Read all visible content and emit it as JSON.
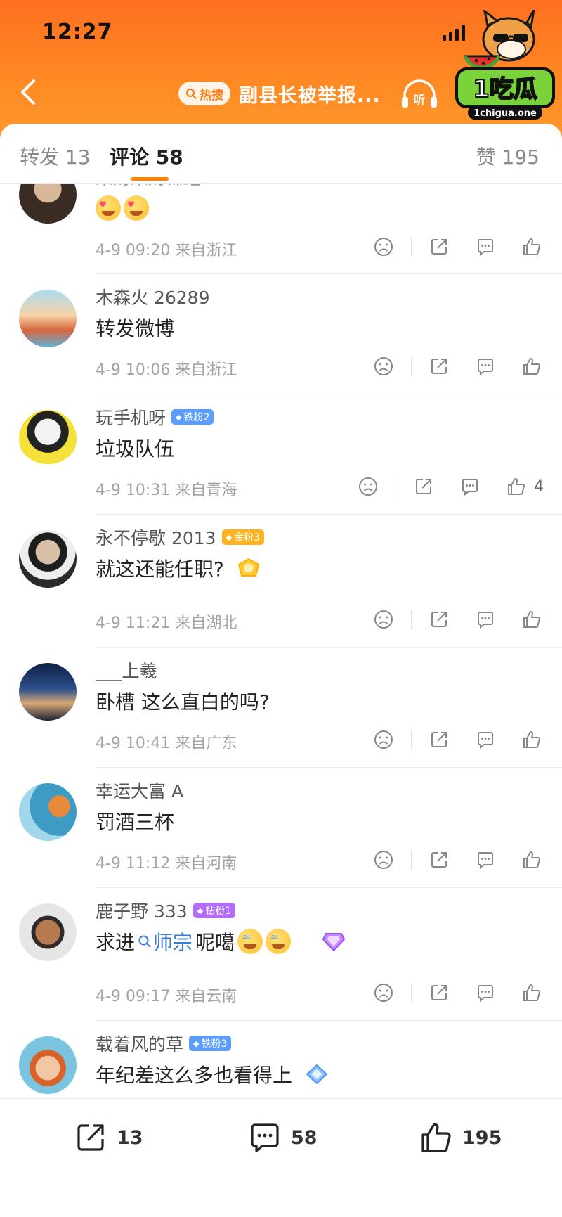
{
  "status_bar": {
    "time": "12:27"
  },
  "header": {
    "hot_label": "热搜",
    "topic_title": "副县长被举报...",
    "listen_label": "听",
    "logo_text": "1吃瓜",
    "logo_domain": "1chigua.one"
  },
  "tabs": {
    "repost": "转发 13",
    "comment": "评论 58",
    "like": "赞 195"
  },
  "comments": [
    {
      "name": "来财来财锦鲤",
      "badge": "",
      "text": "",
      "emojis": [
        "heart-eyes-emoji",
        "heart-eyes-emoji"
      ],
      "meta": "4-9 09:20  来自浙江",
      "likes": ""
    },
    {
      "name": "木森火 26289",
      "badge": "",
      "text": "转发微博",
      "meta": "4-9 10:06  来自浙江",
      "likes": ""
    },
    {
      "name": "玩手机呀",
      "badge": "铁粉2",
      "text": "垃圾队伍",
      "meta": "4-9 10:31  来自青海",
      "likes": "4"
    },
    {
      "name": "永不停歇 2013",
      "badge": "金粉3",
      "text": "就这还能任职?",
      "meta": "4-9 11:21  来自湖北",
      "likes": ""
    },
    {
      "name": "___上羲",
      "badge": "",
      "text": "卧槽 这么直白的吗?",
      "meta": "4-9 10:41  来自广东",
      "likes": ""
    },
    {
      "name": "幸运大富 A",
      "badge": "",
      "text": "罚酒三杯",
      "meta": "4-9 11:12  来自河南",
      "likes": ""
    },
    {
      "name": "鹿子野 333",
      "badge": "钻粉1",
      "text_before": "求进",
      "topic": "师宗",
      "text_after": "呢噶",
      "meta": "4-9 09:17  来自云南",
      "likes": ""
    },
    {
      "name": "载着风的草",
      "badge": "铁粉3",
      "text": "年纪差这么多也看得上",
      "meta": "",
      "likes": ""
    }
  ],
  "bottom_bar": {
    "repost_count": "13",
    "comment_count": "58",
    "like_count": "195"
  },
  "colors": {
    "header_orange": "#ff7a1f",
    "accent": "#ff8200",
    "link_blue": "#3b7bd6",
    "iron_badge": "#5b9cff",
    "gold_badge": "#ffb31f",
    "diamond_badge": "#b46bff"
  }
}
